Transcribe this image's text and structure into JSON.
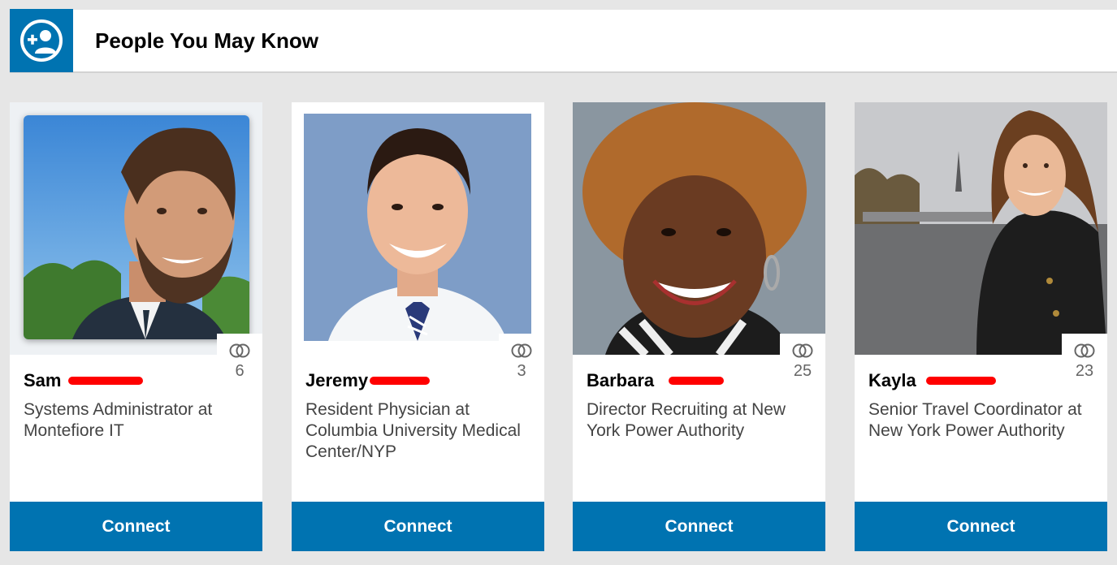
{
  "header": {
    "title": "People You May Know",
    "icon": "add-connection-icon"
  },
  "colors": {
    "accent": "#0073b1",
    "redaction": "#ff0000"
  },
  "people": [
    {
      "first_name": "Sam",
      "headline": "Systems Administrator at Montefiore IT",
      "shared_connections": "6",
      "button": "Connect"
    },
    {
      "first_name": "Jeremy",
      "headline": "Resident Physician at Columbia University Medical Center/NYP",
      "shared_connections": "3",
      "button": "Connect"
    },
    {
      "first_name": "Barbara",
      "headline": "Director Recruiting at New York Power Authority",
      "shared_connections": "25",
      "button": "Connect"
    },
    {
      "first_name": "Kayla",
      "headline": "Senior Travel Coordinator at New York Power Authority",
      "shared_connections": "23",
      "button": "Connect"
    }
  ]
}
